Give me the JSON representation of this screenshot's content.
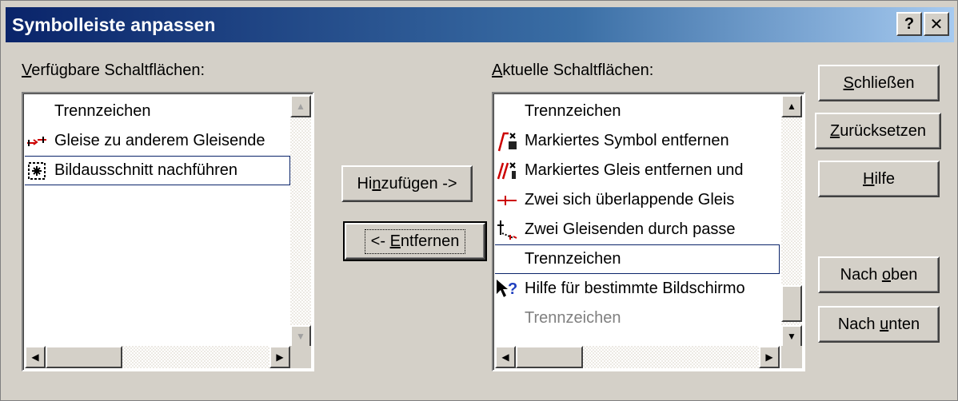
{
  "dialog": {
    "title": "Symbolleiste anpassen",
    "help_btn": "?",
    "close_btn": "✕"
  },
  "available": {
    "label_u": "V",
    "label_rest": "erfügbare Schaltflächen:",
    "items": [
      {
        "icon": "",
        "label": "Trennzeichen",
        "state": "normal"
      },
      {
        "icon": "track-connect-icon",
        "label": "Gleise zu anderem Gleisende",
        "state": "normal"
      },
      {
        "icon": "follow-view-icon",
        "label": "Bildausschnitt nachführen",
        "state": "selected"
      }
    ]
  },
  "current": {
    "label_u": "A",
    "label_rest": "ktuelle Schaltflächen:",
    "items": [
      {
        "icon": "",
        "label": "Trennzeichen",
        "state": "normal"
      },
      {
        "icon": "remove-symbol-icon",
        "label": "Markiertes Symbol entfernen",
        "state": "normal"
      },
      {
        "icon": "remove-track-icon",
        "label": "Markiertes Gleis entfernen und",
        "state": "normal"
      },
      {
        "icon": "overlap-tracks-icon",
        "label": "Zwei sich überlappende Gleis",
        "state": "normal"
      },
      {
        "icon": "connect-ends-icon",
        "label": "Zwei Gleisenden durch passe",
        "state": "normal"
      },
      {
        "icon": "",
        "label": "Trennzeichen",
        "state": "selected"
      },
      {
        "icon": "help-cursor-icon",
        "label": "Hilfe für bestimmte Bildschirmo",
        "state": "normal"
      },
      {
        "icon": "",
        "label": "Trennzeichen",
        "state": "disabled"
      }
    ]
  },
  "buttons": {
    "add_pre": "Hi",
    "add_u": "n",
    "add_post": "zufügen ->",
    "remove_pre": "<- ",
    "remove_u": "E",
    "remove_post": "ntfernen",
    "close_u": "S",
    "close_post": "chließen",
    "reset_u": "Z",
    "reset_post": "urücksetzen",
    "help_u": "H",
    "help_post": "ilfe",
    "up_pre": "Nach ",
    "up_u": "o",
    "up_post": "ben",
    "down_pre": "Nach ",
    "down_u": "u",
    "down_post": "nten"
  },
  "colors": {
    "face": "#d4d0c8",
    "title_start": "#0a246a",
    "title_end": "#a6caf0"
  }
}
